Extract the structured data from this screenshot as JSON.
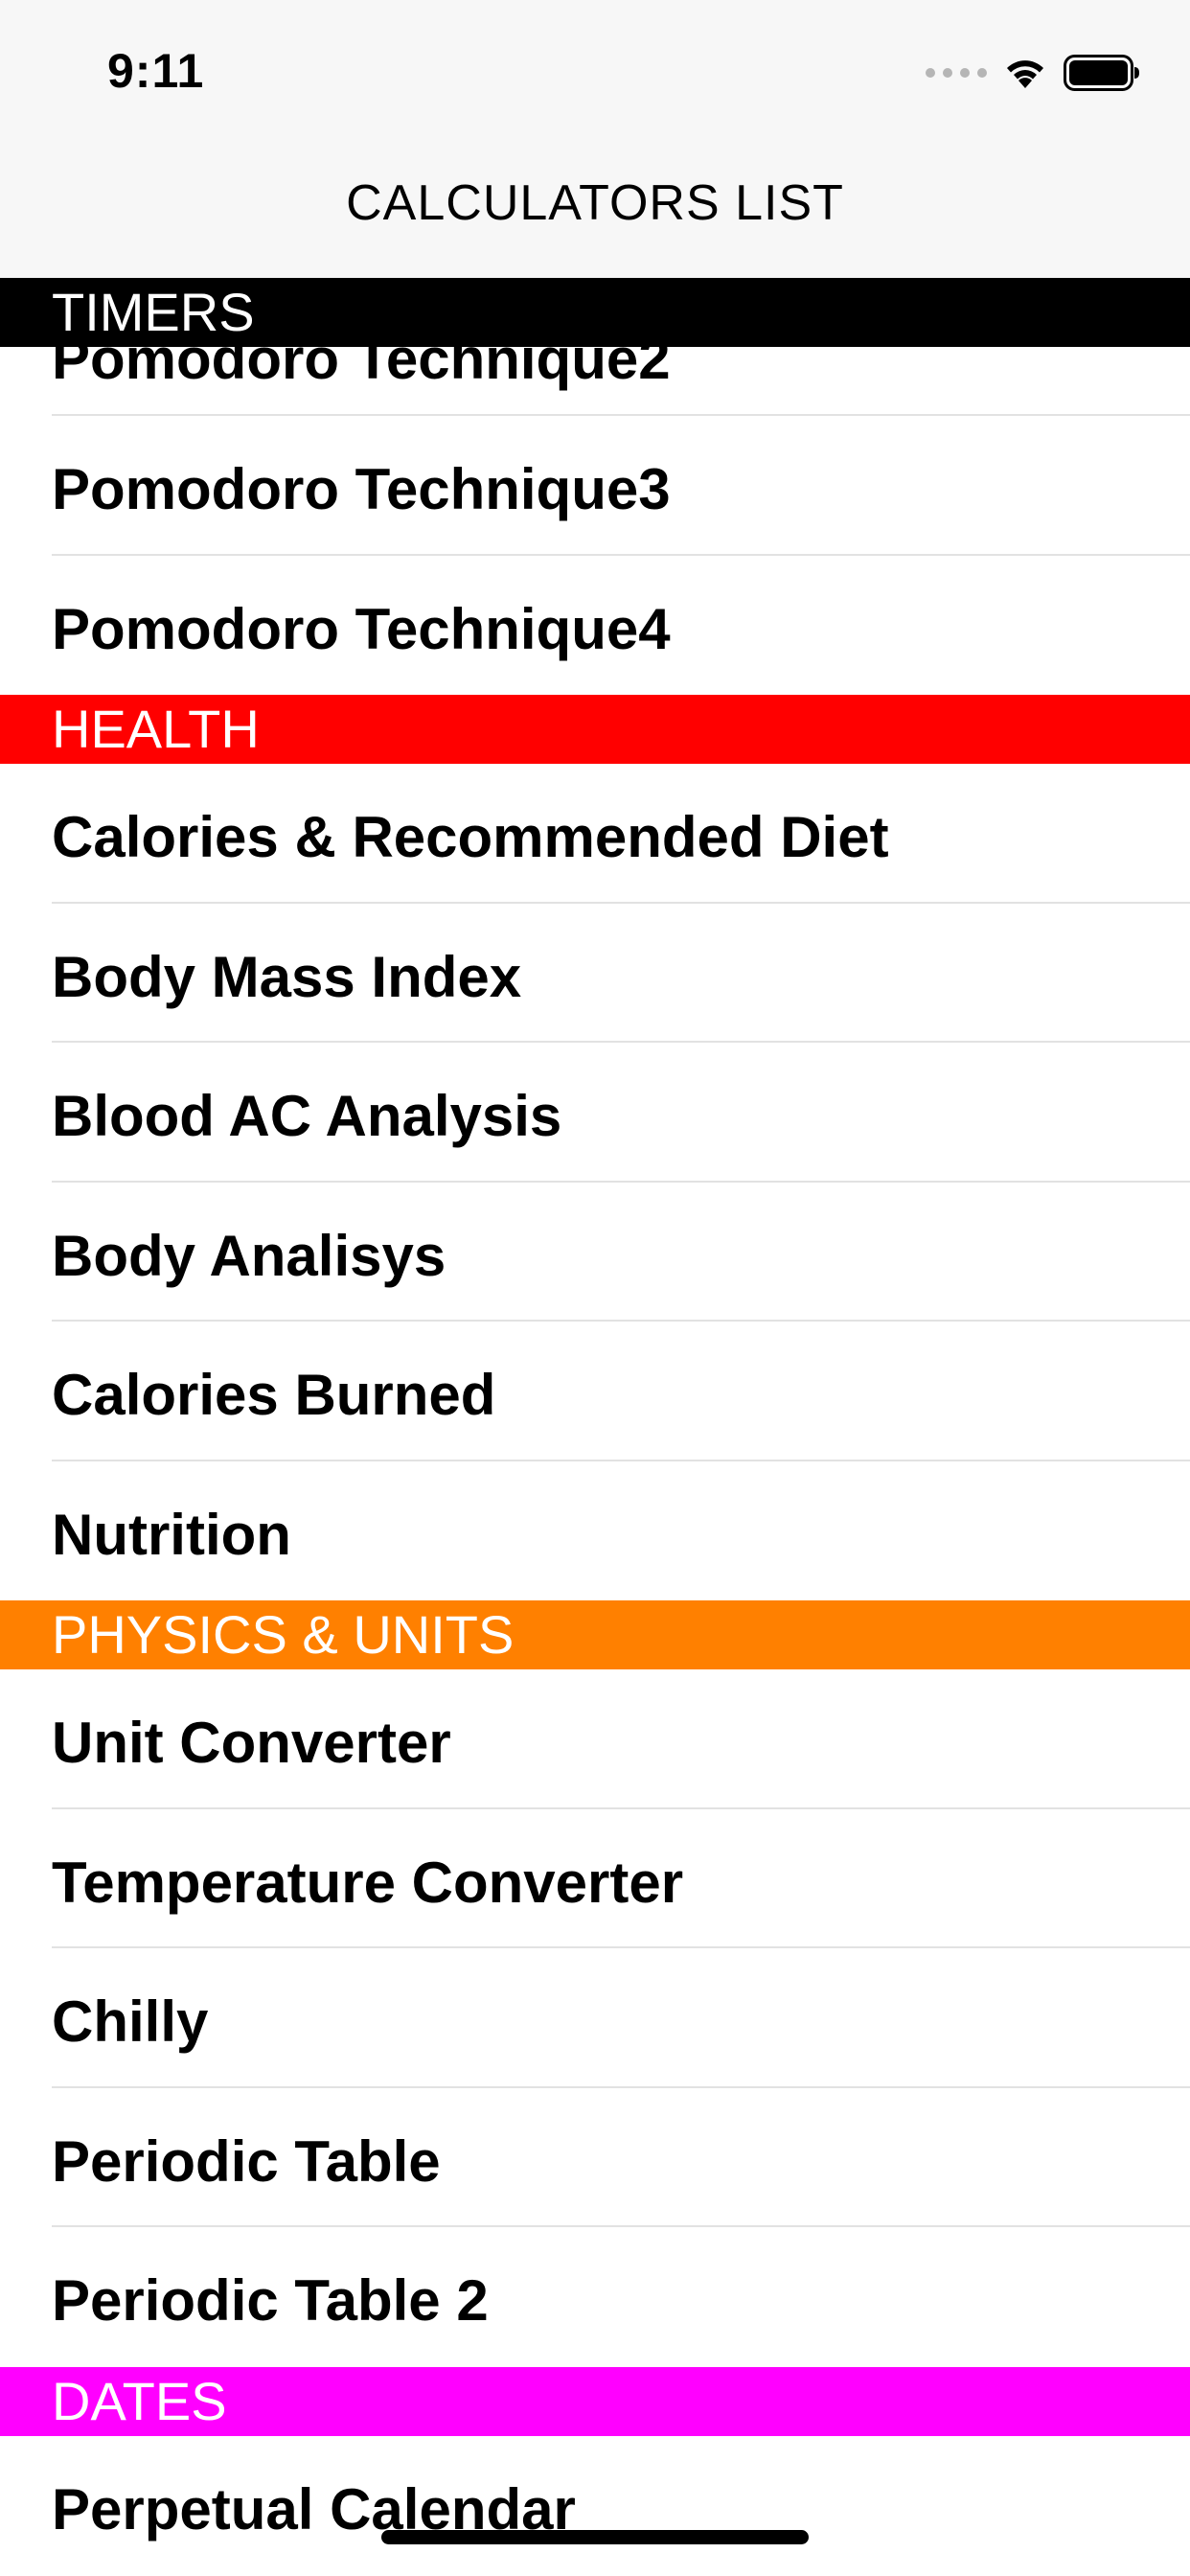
{
  "status_bar": {
    "time": "9:11",
    "icons": [
      "signal-dots-icon",
      "wifi-icon",
      "battery-icon"
    ]
  },
  "nav": {
    "title": "CALCULATORS LIST"
  },
  "colors": {
    "timers": "#000000",
    "health": "#ff0000",
    "physics": "#ff8000",
    "dates": "#ff00ff"
  },
  "sections": [
    {
      "title": "TIMERS",
      "items": [
        "Pomodoro Technique2",
        "Pomodoro Technique3",
        "Pomodoro Technique4"
      ]
    },
    {
      "title": "HEALTH",
      "items": [
        "Calories & Recommended Diet",
        "Body Mass Index",
        "Blood AC Analysis",
        "Body Analisys",
        "Calories Burned",
        "Nutrition"
      ]
    },
    {
      "title": "PHYSICS & UNITS",
      "items": [
        "Unit Converter",
        "Temperature Converter",
        "Chilly",
        "Periodic Table",
        "Periodic Table 2"
      ]
    },
    {
      "title": "DATES",
      "items": [
        "Perpetual Calendar"
      ]
    }
  ]
}
